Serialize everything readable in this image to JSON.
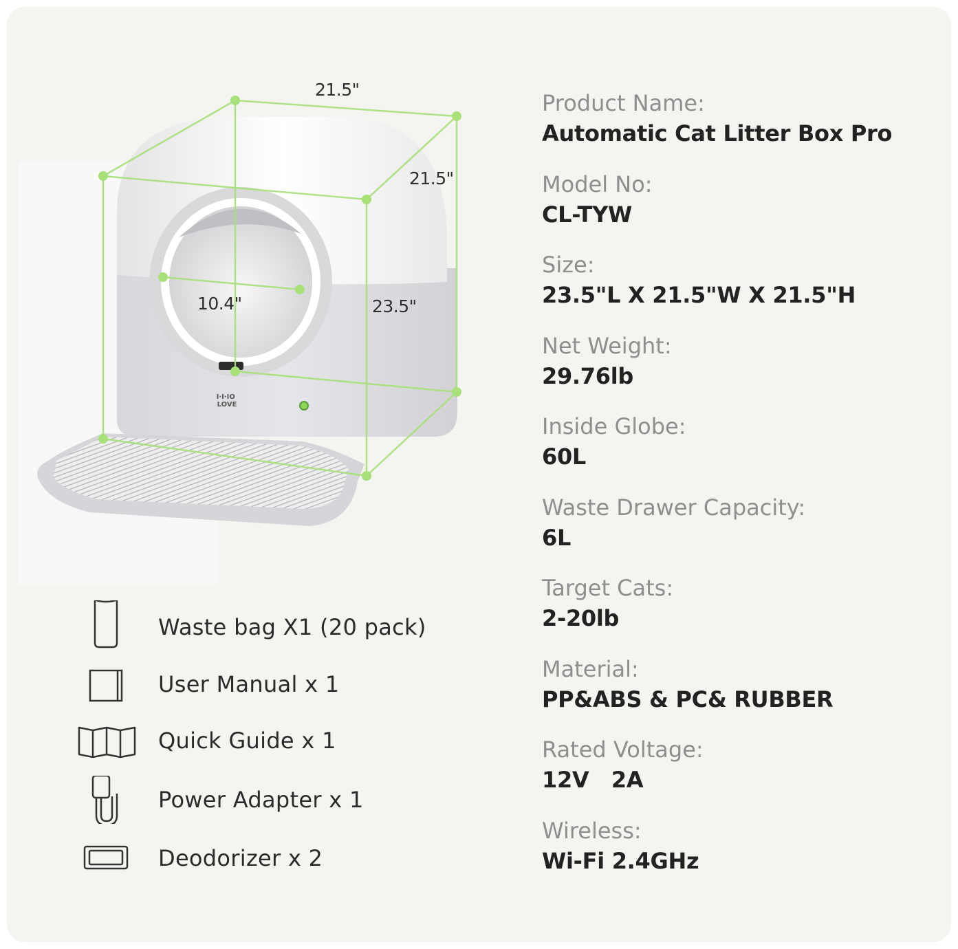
{
  "colors": {
    "background": "#f4f4f1",
    "guide_lines": "#a8e07a",
    "label": "#8e8e8e",
    "value": "#222222"
  },
  "product": {
    "logo_lines": [
      "I·I·IO",
      "LOVE"
    ],
    "dimensions": {
      "top_width": "21.5\"",
      "depth": "21.5\"",
      "height": "23.5\"",
      "opening": "10.4\""
    }
  },
  "specs": [
    {
      "label": "Product Name:",
      "value": "Automatic Cat Litter Box Pro"
    },
    {
      "label": "Model No:",
      "value": "CL-TYW"
    },
    {
      "label": "Size:",
      "value": "23.5\"L X 21.5\"W X 21.5\"H"
    },
    {
      "label": "Net Weight:",
      "value": "29.76lb"
    },
    {
      "label": "Inside Globe:",
      "value": "60L"
    },
    {
      "label": "Waste Drawer Capacity:",
      "value": "6L"
    },
    {
      "label": "Target Cats:",
      "value": "2-20lb"
    },
    {
      "label": "Material:",
      "value": "PP&ABS & PC& RUBBER"
    },
    {
      "label": "Rated Voltage:",
      "value": "12V   2A"
    },
    {
      "label": "Wireless:",
      "value": "Wi-Fi 2.4GHz"
    }
  ],
  "accessories": [
    {
      "icon": "waste-bag-roll-icon",
      "label": "Waste bag X1 (20 pack)"
    },
    {
      "icon": "user-manual-icon",
      "label": "User Manual x 1"
    },
    {
      "icon": "quick-guide-icon",
      "label": "Quick Guide x 1"
    },
    {
      "icon": "power-adapter-icon",
      "label": "Power Adapter x 1"
    },
    {
      "icon": "deodorizer-icon",
      "label": "Deodorizer x 2"
    }
  ]
}
